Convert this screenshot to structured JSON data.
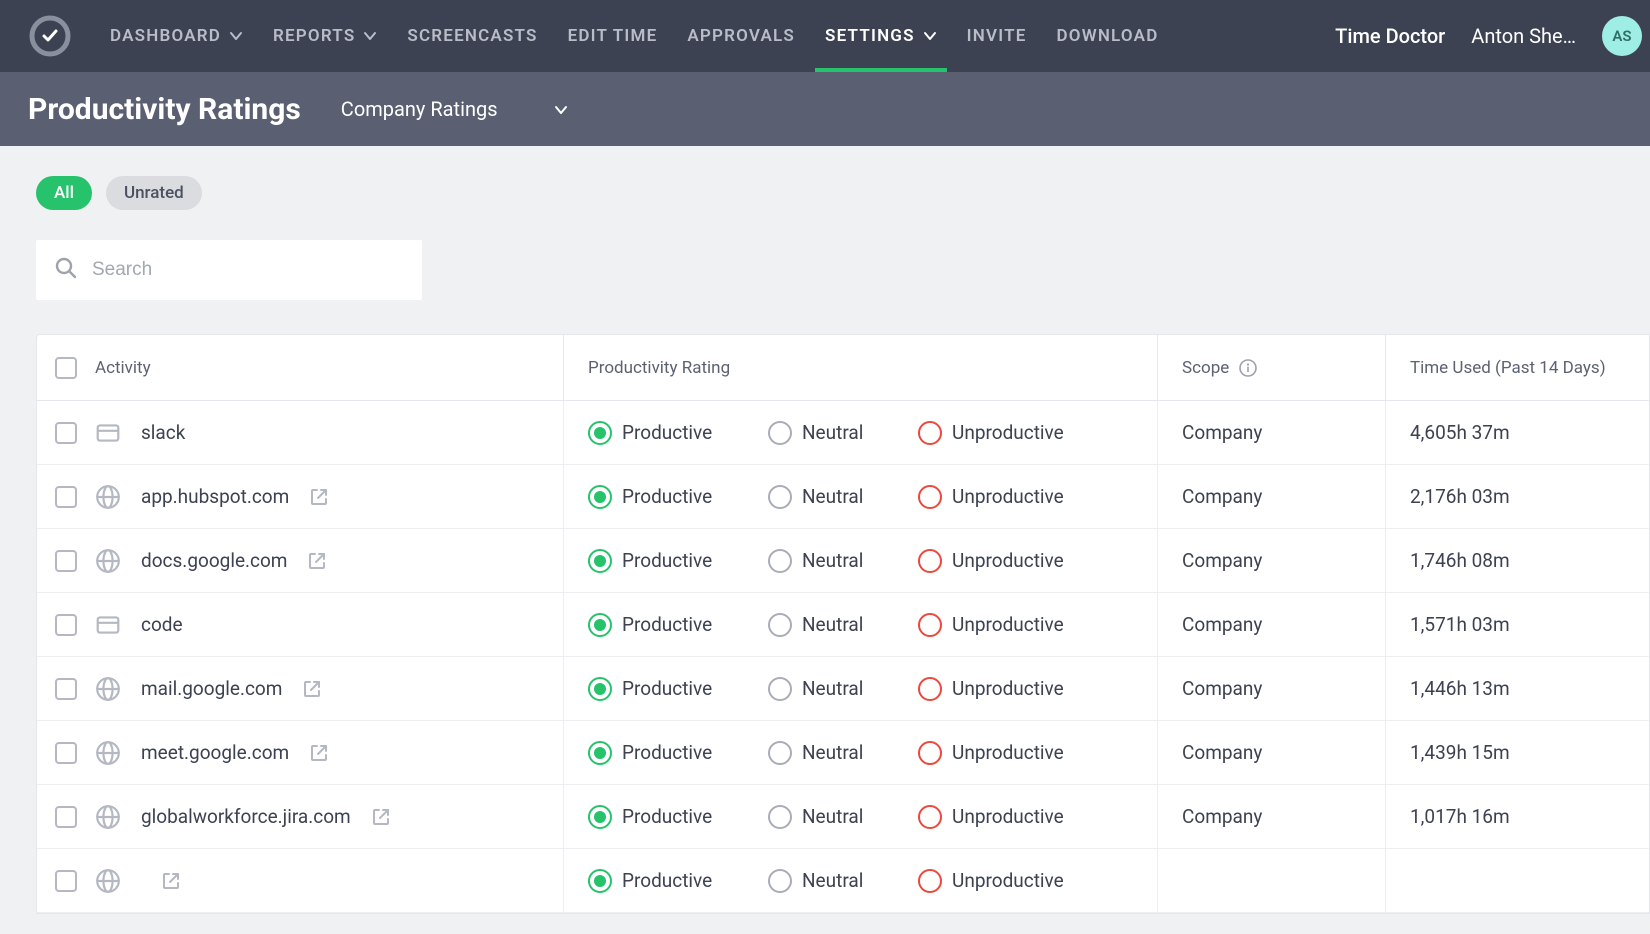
{
  "nav": {
    "items": [
      {
        "label": "DASHBOARD",
        "has_chevron": true
      },
      {
        "label": "REPORTS",
        "has_chevron": true
      },
      {
        "label": "SCREENCASTS"
      },
      {
        "label": "EDIT TIME"
      },
      {
        "label": "APPROVALS"
      },
      {
        "label": "SETTINGS",
        "has_chevron": true,
        "active": true
      },
      {
        "label": "INVITE"
      },
      {
        "label": "DOWNLOAD"
      }
    ],
    "brand": "Time Doctor",
    "user_name": "Anton She…",
    "avatar_initials": "AS"
  },
  "subheader": {
    "title": "Productivity Ratings",
    "scope_label": "Company Ratings"
  },
  "filters": {
    "all": "All",
    "unrated": "Unrated"
  },
  "search": {
    "placeholder": "Search"
  },
  "columns": {
    "activity": "Activity",
    "rating": "Productivity Rating",
    "scope": "Scope",
    "time": "Time Used (Past 14 Days)"
  },
  "rating_labels": {
    "productive": "Productive",
    "neutral": "Neutral",
    "unproductive": "Unproductive"
  },
  "rows": [
    {
      "icon": "app",
      "name": "slack",
      "external": false,
      "selected": "productive",
      "scope": "Company",
      "time": "4,605h 37m"
    },
    {
      "icon": "web",
      "name": "app.hubspot.com",
      "external": true,
      "selected": "productive",
      "scope": "Company",
      "time": "2,176h 03m"
    },
    {
      "icon": "web",
      "name": "docs.google.com",
      "external": true,
      "selected": "productive",
      "scope": "Company",
      "time": "1,746h 08m"
    },
    {
      "icon": "app",
      "name": "code",
      "external": false,
      "selected": "productive",
      "scope": "Company",
      "time": "1,571h 03m"
    },
    {
      "icon": "web",
      "name": "mail.google.com",
      "external": true,
      "selected": "productive",
      "scope": "Company",
      "time": "1,446h 13m"
    },
    {
      "icon": "web",
      "name": "meet.google.com",
      "external": true,
      "selected": "productive",
      "scope": "Company",
      "time": "1,439h 15m"
    },
    {
      "icon": "web",
      "name": "globalworkforce.jira.com",
      "external": true,
      "selected": "productive",
      "scope": "Company",
      "time": "1,017h 16m"
    },
    {
      "icon": "web",
      "name": "",
      "external": true,
      "selected": "productive",
      "scope": "",
      "time": ""
    }
  ]
}
